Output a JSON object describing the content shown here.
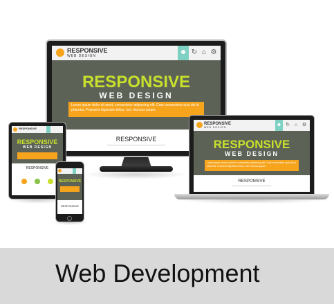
{
  "caption": {
    "title": "Web Development"
  },
  "illustration": {
    "brand": "RESPONSIVE",
    "brand_sub": "WEB DESIGN",
    "hero_title": "RESPONSIVE",
    "hero_subtitle": "WEB DESIGN",
    "hero_text": "Lorem ipsum dolor sit amet, consectetur adipiscing elit. Cras consectetur quis dui id pharetra. Praesent dignissim tellus, nec rhoncus ipsum.",
    "section_label": "RESPONSIVE",
    "nav_icons": [
      "user-icon",
      "refresh-icon",
      "home-icon",
      "gear-icon"
    ],
    "colors": {
      "accent_green": "#c8e02c",
      "accent_orange": "#f6a41c",
      "accent_teal": "#7fd1c3",
      "hero_bg": "#5d6257",
      "device_black": "#1c1c1c"
    }
  }
}
